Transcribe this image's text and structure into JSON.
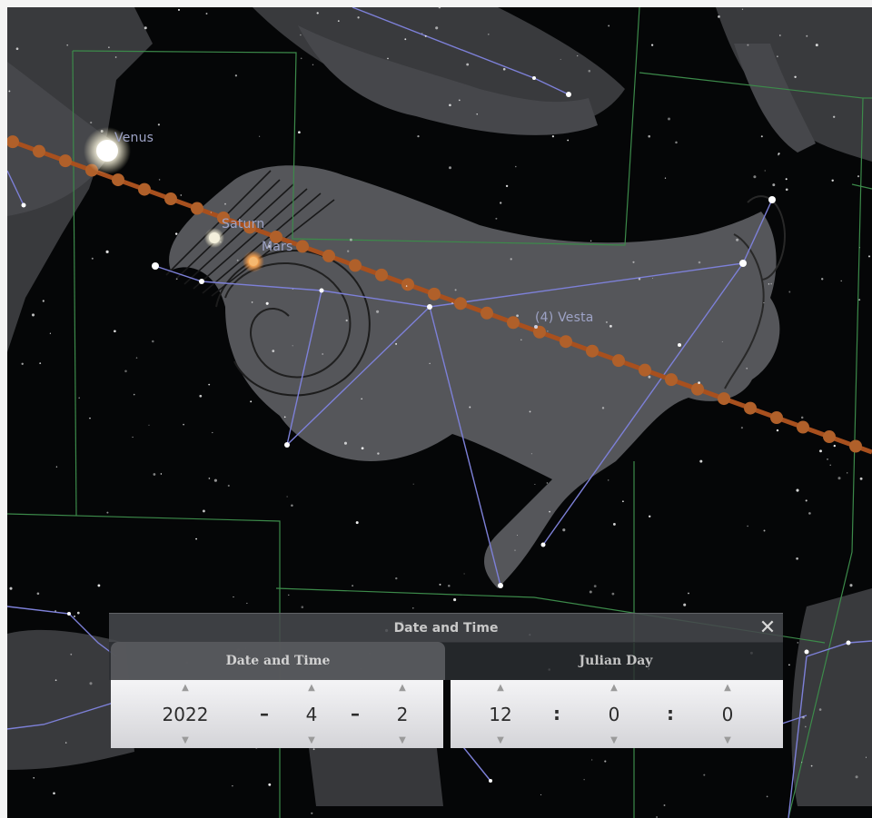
{
  "sky": {
    "labels": {
      "venus": "Venus",
      "saturn": "Saturn",
      "mars": "Mars",
      "vesta": "(4) Vesta"
    }
  },
  "dialog": {
    "title": "Date and Time",
    "close_glyph": "✕",
    "tabs": [
      {
        "label": "Date and Time",
        "selected": true
      },
      {
        "label": "Julian Day",
        "selected": false
      }
    ],
    "date": {
      "year": "2022",
      "month": "4",
      "day": "2",
      "separator": "–"
    },
    "time": {
      "hour": "12",
      "minute": "0",
      "second": "0",
      "separator": ":"
    },
    "spin_up_glyph": "▲",
    "spin_down_glyph": "▼"
  },
  "colors": {
    "ecliptic": "#a8501e",
    "constellation_line": "#7d80d8",
    "boundary": "#3c8a4a"
  }
}
